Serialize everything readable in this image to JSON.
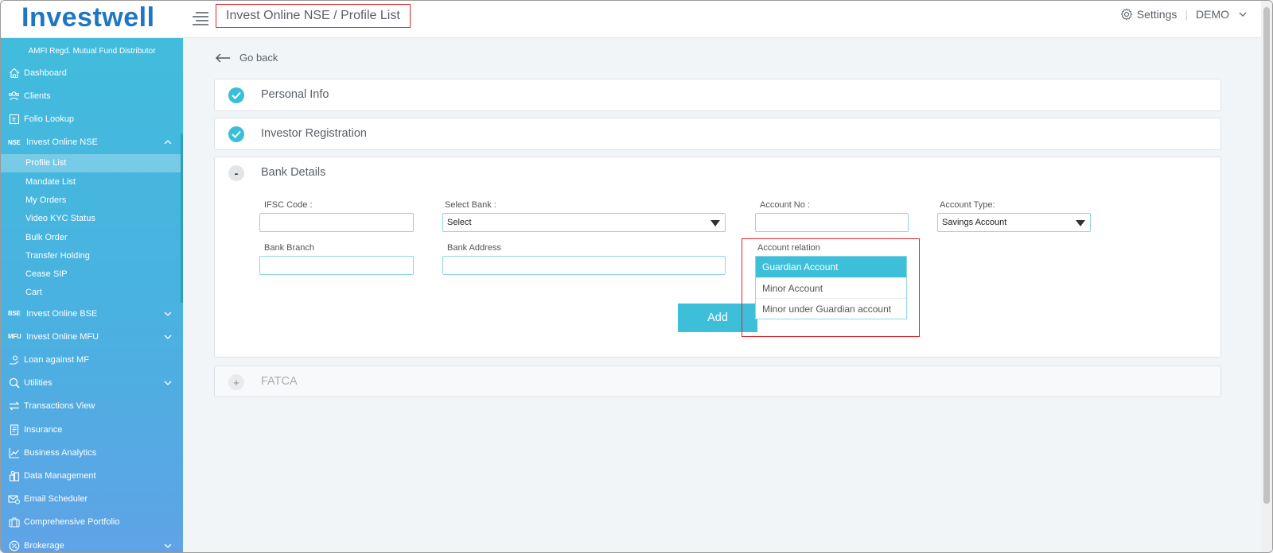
{
  "app": {
    "logo": "Investwell",
    "breadcrumb": "Invest Online NSE / Profile List",
    "settings_label": "Settings",
    "user_label": "DEMO"
  },
  "sidebar": {
    "subtitle": "AMFI Regd. Mutual Fund Distributor",
    "items": [
      {
        "label": "Dashboard",
        "icon": "home-icon"
      },
      {
        "label": "Clients",
        "icon": "users-icon"
      },
      {
        "label": "Folio Lookup",
        "icon": "folio-icon"
      },
      {
        "label": "Invest Online NSE",
        "tag": "NSE",
        "expanded": true
      },
      {
        "label": "Invest Online BSE",
        "tag": "BSE"
      },
      {
        "label": "Invest Online MFU",
        "tag": "MFU"
      },
      {
        "label": "Loan against MF",
        "icon": "loan-icon"
      },
      {
        "label": "Utilities",
        "icon": "utilities-icon"
      },
      {
        "label": "Transactions View",
        "icon": "transactions-icon"
      },
      {
        "label": "Insurance",
        "icon": "insurance-icon"
      },
      {
        "label": "Business Analytics",
        "icon": "analytics-icon"
      },
      {
        "label": "Data Management",
        "icon": "database-icon"
      },
      {
        "label": "Email Scheduler",
        "icon": "email-icon"
      },
      {
        "label": "Comprehensive Portfolio",
        "icon": "portfolio-icon"
      },
      {
        "label": "Brokerage",
        "icon": "brokerage-icon"
      }
    ],
    "nse_sub_items": [
      {
        "label": "Profile List",
        "active": true
      },
      {
        "label": "Mandate List"
      },
      {
        "label": "My Orders"
      },
      {
        "label": "Video KYC Status"
      },
      {
        "label": "Bulk Order"
      },
      {
        "label": "Transfer Holding"
      },
      {
        "label": "Cease SIP"
      },
      {
        "label": "Cart"
      }
    ]
  },
  "main": {
    "go_back": "Go back",
    "sections": [
      {
        "title": "Personal Info",
        "state": "completed"
      },
      {
        "title": "Investor Registration",
        "state": "completed"
      },
      {
        "title": "Bank Details",
        "state": "open",
        "toggle": "-"
      },
      {
        "title": "FATCA",
        "state": "locked",
        "toggle": "+"
      }
    ],
    "bank": {
      "ifsc_label": "IFSC Code :",
      "ifsc_value": "",
      "select_bank_label": "Select Bank :",
      "select_bank_value": "Select",
      "account_no_label": "Account No :",
      "account_no_value": "",
      "account_type_label": "Account Type:",
      "account_type_value": "Savings Account",
      "branch_label": "Bank Branch",
      "branch_value": "",
      "address_label": "Bank Address",
      "address_value": "",
      "relation_label": "Account relation",
      "relation_options": [
        "Guardian Account",
        "Minor Account",
        "Minor under Guardian account"
      ],
      "relation_selected": "Guardian Account",
      "add_button": "Add"
    }
  },
  "colors": {
    "accent": "#3dbfd9",
    "brand": "#1f76c4",
    "highlight": "#e0262b"
  }
}
